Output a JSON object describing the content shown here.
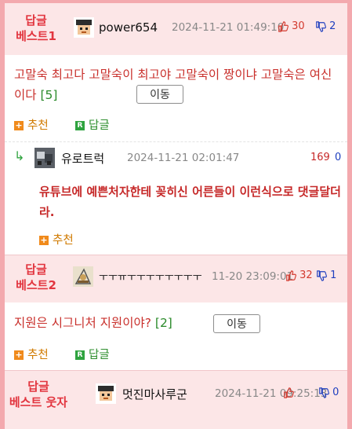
{
  "posts": [
    {
      "badge": "답글\n베스트1",
      "nick": "power654",
      "date": "2024-11-21 01:49:10",
      "up": "30",
      "down": "2",
      "text": "고말숙 최고다 고말숙이 최고야 고말숙이 짱이냐 고말숙은 여신이다",
      "count": "[5]",
      "move": "이동",
      "recommend": "추천",
      "reply": "답글"
    },
    {
      "nick": "유로트럭",
      "date": "2024-11-21 02:01:47",
      "up": "169",
      "down": "0",
      "text": "유튜브에 예쁜처자한테 꽂히신 어른들이 이런식으로 댓글달더라.",
      "recommend": "추천"
    },
    {
      "badge": "답글\n베스트2",
      "nick": "ㅜㅜㅠㅜㅜㅜㅜㅜㅜㅜㅜ",
      "date": "11-20 23:09:01",
      "up": "32",
      "down": "1",
      "text": "지원은 시그니처 지원이야?",
      "count": "[2]",
      "move": "이동",
      "recommend": "추천",
      "reply": "답글"
    },
    {
      "badge": "답글\n베스트 웃자",
      "nick": "멋진마사루군",
      "date": "2024-11-21 09:25:13",
      "up": "",
      "down": "0"
    }
  ],
  "colors": {
    "accent": "#e2353f",
    "border": "#f3a9ae",
    "header_bg": "#fce6e7"
  },
  "icons": [
    "thumbs-up-icon",
    "thumbs-down-icon",
    "plus-icon",
    "reply-icon",
    "reply-arrow-icon"
  ]
}
